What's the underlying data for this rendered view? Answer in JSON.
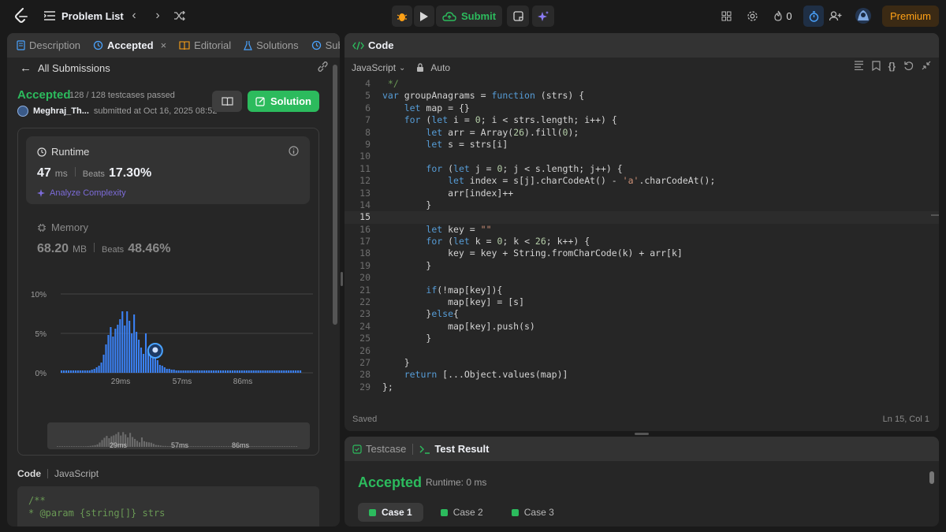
{
  "topbar": {
    "problem_list": "Problem List",
    "submit": "Submit",
    "streak": "0",
    "premium": "Premium"
  },
  "left_tabs": [
    {
      "label": "Description"
    },
    {
      "label": "Accepted"
    },
    {
      "label": "Editorial"
    },
    {
      "label": "Solutions"
    },
    {
      "label": "Subm"
    }
  ],
  "submission": {
    "back_label": "All Submissions",
    "status": "Accepted",
    "testcases": "128 / 128 testcases passed",
    "author": "Meghraj_Th...",
    "submitted_at": "submitted at Oct 16, 2025 08:52",
    "solution_button": "Solution"
  },
  "runtime": {
    "title": "Runtime",
    "value": "47",
    "unit": "ms",
    "beats_label": "Beats",
    "beats_value": "17.30%",
    "analyze": "Analyze Complexity"
  },
  "memory": {
    "title": "Memory",
    "value": "68.20",
    "unit": "MB",
    "beats_label": "Beats",
    "beats_value": "48.46%"
  },
  "chart_data": {
    "type": "bar",
    "ylabel_ticks": [
      "10%",
      "5%",
      "0%"
    ],
    "xticks": [
      "29ms",
      "57ms",
      "86ms"
    ],
    "mini_xticks": [
      "29ms",
      "57ms",
      "86ms"
    ],
    "ylim": [
      0,
      10
    ],
    "highlight_index": 40,
    "values": [
      0.3,
      0.3,
      0.3,
      0.3,
      0.3,
      0.3,
      0.3,
      0.3,
      0.3,
      0.3,
      0.3,
      0.3,
      0.3,
      0.4,
      0.5,
      0.7,
      0.9,
      1.3,
      2.3,
      3.6,
      4.8,
      5.8,
      4.6,
      5.6,
      6.1,
      6.8,
      7.8,
      6.0,
      7.8,
      6.6,
      5.0,
      7.4,
      5.2,
      4.2,
      3.2,
      2.4,
      5.0,
      3.0,
      2.6,
      2.4,
      2.2,
      1.6,
      1.0,
      0.9,
      0.7,
      0.5,
      0.5,
      0.4,
      0.4,
      0.3,
      0.3,
      0.3,
      0.3,
      0.3,
      0.3,
      0.3,
      0.3,
      0.3,
      0.3,
      0.3,
      0.3,
      0.3,
      0.3,
      0.3,
      0.3,
      0.3,
      0.3,
      0.3,
      0.3,
      0.3,
      0.3,
      0.3,
      0.3,
      0.3,
      0.3,
      0.3,
      0.3,
      0.3,
      0.3,
      0.3,
      0.3,
      0.3,
      0.3,
      0.3,
      0.3,
      0.3,
      0.3,
      0.3,
      0.3,
      0.3,
      0.3,
      0.3,
      0.3,
      0.3,
      0.3,
      0.3,
      0.3,
      0.3,
      0.3,
      0.3,
      0.3,
      0.3,
      0.3
    ]
  },
  "code_section": {
    "label": "Code",
    "lang": "JavaScript",
    "preview": [
      "/**",
      " * @param {string[]} strs"
    ]
  },
  "editor": {
    "title": "Code",
    "language": "JavaScript",
    "mode": "Auto",
    "status": "Saved",
    "cursor": "Ln 15, Col 1",
    "current_line": 15,
    "lines": [
      {
        "n": "4",
        "t": " */"
      },
      {
        "n": "5",
        "t": "var groupAnagrams = function (strs) {"
      },
      {
        "n": "6",
        "t": "    let map = {}"
      },
      {
        "n": "7",
        "t": "    for (let i = 0; i < strs.length; i++) {"
      },
      {
        "n": "8",
        "t": "        let arr = Array(26).fill(0);"
      },
      {
        "n": "9",
        "t": "        let s = strs[i]"
      },
      {
        "n": "10",
        "t": ""
      },
      {
        "n": "11",
        "t": "        for (let j = 0; j < s.length; j++) {"
      },
      {
        "n": "12",
        "t": "            let index = s[j].charCodeAt() - 'a'.charCodeAt();"
      },
      {
        "n": "13",
        "t": "            arr[index]++"
      },
      {
        "n": "14",
        "t": "        }"
      },
      {
        "n": "15",
        "t": ""
      },
      {
        "n": "16",
        "t": "        let key = \"\""
      },
      {
        "n": "17",
        "t": "        for (let k = 0; k < 26; k++) {"
      },
      {
        "n": "18",
        "t": "            key = key + String.fromCharCode(k) + arr[k]"
      },
      {
        "n": "19",
        "t": "        }"
      },
      {
        "n": "20",
        "t": ""
      },
      {
        "n": "21",
        "t": "        if(!map[key]){"
      },
      {
        "n": "22",
        "t": "            map[key] = [s]"
      },
      {
        "n": "23",
        "t": "        }else{"
      },
      {
        "n": "24",
        "t": "            map[key].push(s)"
      },
      {
        "n": "25",
        "t": "        }"
      },
      {
        "n": "26",
        "t": ""
      },
      {
        "n": "27",
        "t": "    }"
      },
      {
        "n": "28",
        "t": "    return [...Object.values(map)]"
      },
      {
        "n": "29",
        "t": "};"
      }
    ]
  },
  "test": {
    "tab_testcase": "Testcase",
    "tab_result": "Test Result",
    "status": "Accepted",
    "runtime": "Runtime: 0 ms",
    "cases": [
      {
        "label": "Case 1"
      },
      {
        "label": "Case 2"
      },
      {
        "label": "Case 3"
      }
    ]
  },
  "colors": {
    "accent_green": "#2cbb5d",
    "bar_blue": "#3b82f6",
    "premium_orange": "#ffa116"
  }
}
